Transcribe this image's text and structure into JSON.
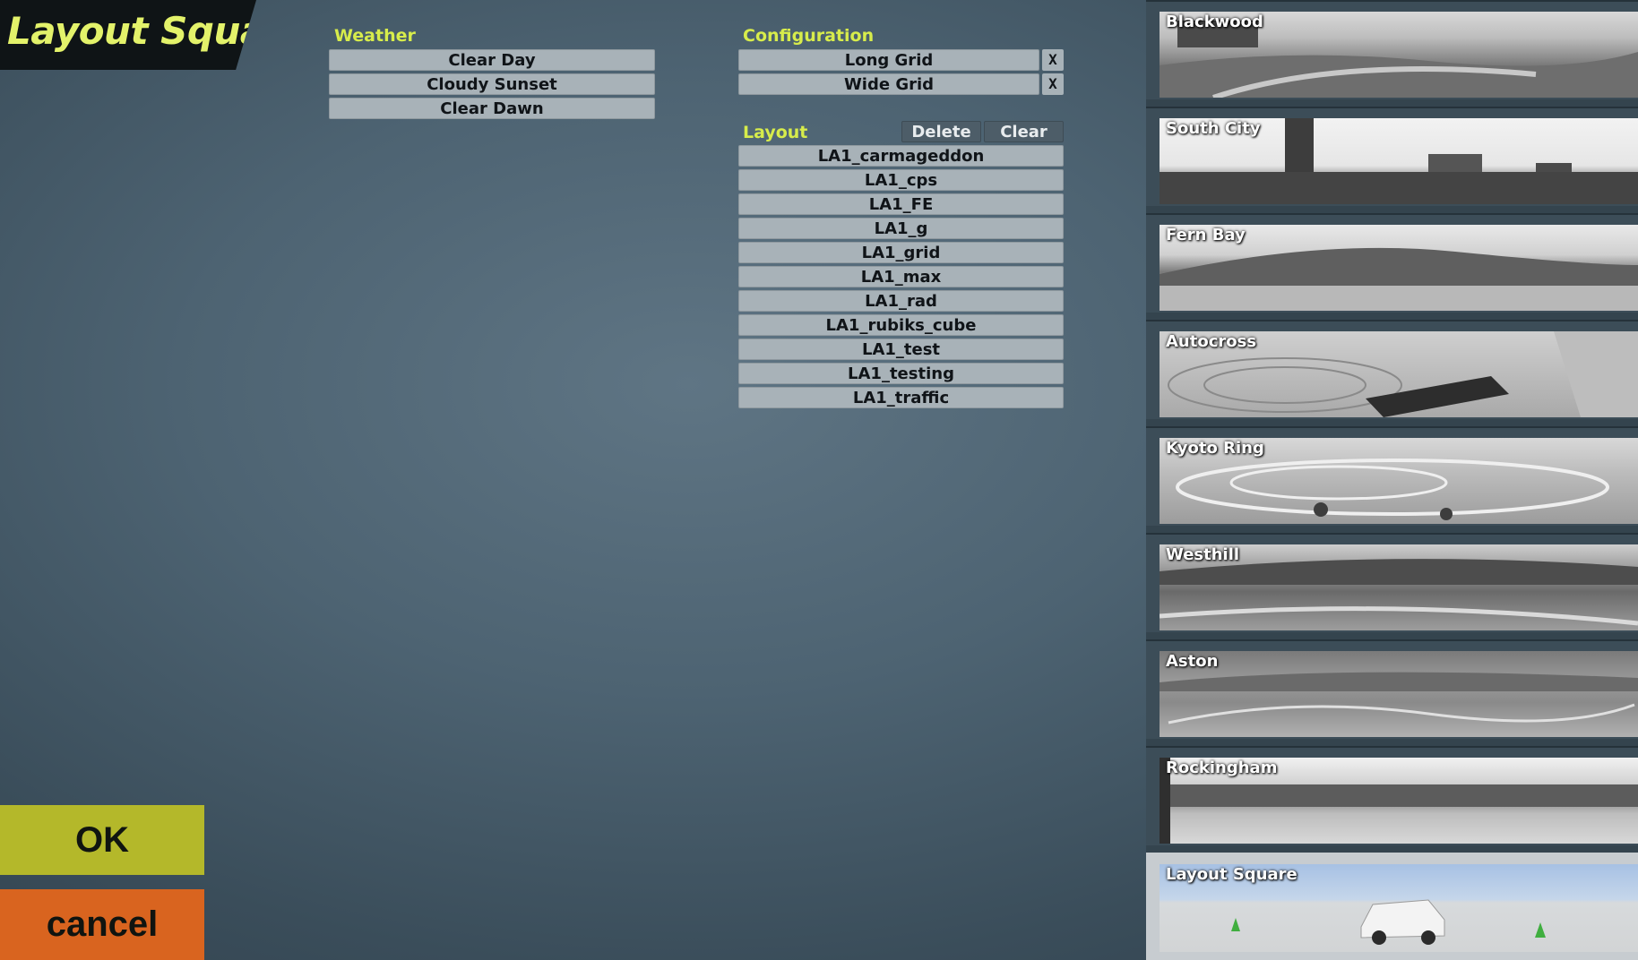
{
  "page": {
    "title": "Layout Square"
  },
  "weather": {
    "label": "Weather",
    "options": [
      "Clear Day",
      "Cloudy Sunset",
      "Clear Dawn"
    ]
  },
  "configuration": {
    "label": "Configuration",
    "options": [
      "Long Grid",
      "Wide Grid"
    ],
    "remove_glyph": "X"
  },
  "layout": {
    "label": "Layout",
    "delete_label": "Delete",
    "clear_label": "Clear",
    "items": [
      "LA1_carmageddon",
      "LA1_cps",
      "LA1_FE",
      "LA1_g",
      "LA1_grid",
      "LA1_max",
      "LA1_rad",
      "LA1_rubiks_cube",
      "LA1_test",
      "LA1_testing",
      "LA1_traffic"
    ]
  },
  "actions": {
    "ok_label": "OK",
    "cancel_label": "cancel"
  },
  "tracks": [
    {
      "name": "Blackwood",
      "selected": false
    },
    {
      "name": "South City",
      "selected": false
    },
    {
      "name": "Fern Bay",
      "selected": false
    },
    {
      "name": "Autocross",
      "selected": false
    },
    {
      "name": "Kyoto Ring",
      "selected": false
    },
    {
      "name": "Westhill",
      "selected": false
    },
    {
      "name": "Aston",
      "selected": false
    },
    {
      "name": "Rockingham",
      "selected": false
    },
    {
      "name": "Layout Square",
      "selected": true
    }
  ],
  "colors": {
    "accent": "#d7ec4b",
    "ok": "#b4b82a",
    "cancel": "#d9641f",
    "list_button": "#a8b2b8"
  }
}
